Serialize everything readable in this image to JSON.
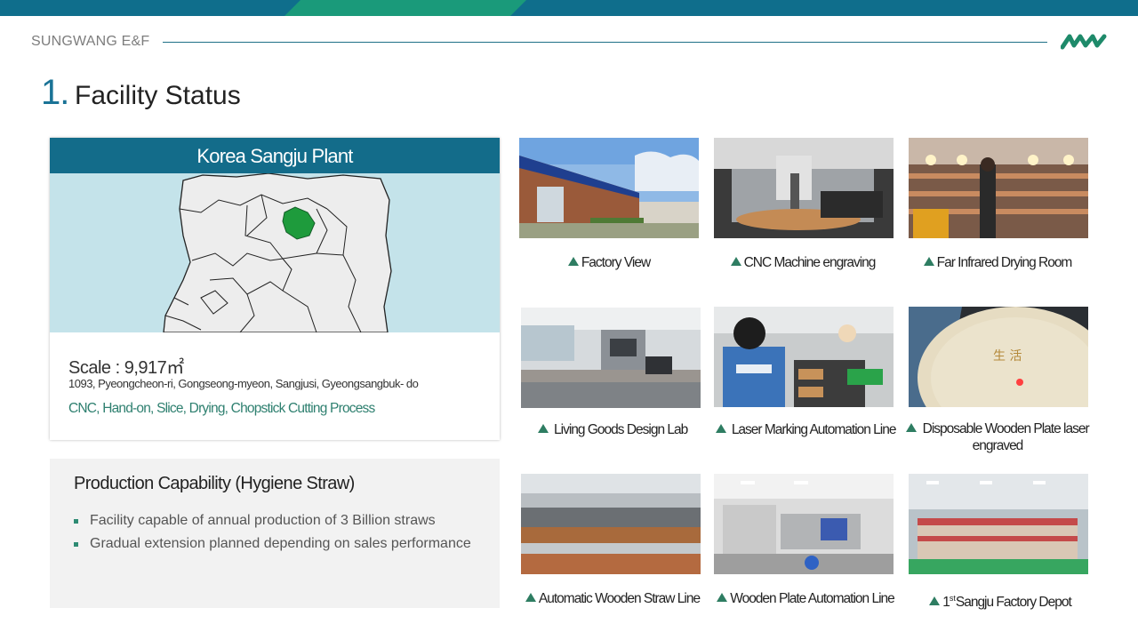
{
  "header": {
    "brand": "SUNGWANG E&F",
    "section_number": "1.",
    "section_title": "Facility Status"
  },
  "plant": {
    "title": "Korea Sangju Plant",
    "scale": "Scale : 9,917㎡",
    "address": "1093, Pyeongcheon-ri,  Gongseong-myeon,  Sangjusi,  Gyeongsangbuk-  do",
    "process": "CNC, Hand-on, Slice, Drying, Chopstick Cutting Process"
  },
  "capability": {
    "title": "Production Capability (Hygiene Straw)",
    "items": [
      "Facility capable of annual production of 3 Billion straws",
      "Gradual extension planned depending on sales performance"
    ]
  },
  "photos": [
    {
      "caption": "Factory View"
    },
    {
      "caption": "CNC Machine engraving"
    },
    {
      "caption": "Far Infrared Drying Room"
    },
    {
      "caption": "Living Goods Design Lab"
    },
    {
      "caption": "Laser Marking Automation Line"
    },
    {
      "caption": "Disposable Wooden Plate laser engraved"
    },
    {
      "caption": "Automatic Wooden Straw Line"
    },
    {
      "caption": "Wooden Plate Automation Line"
    },
    {
      "caption_prefix": "1",
      "caption_sup": "st",
      "caption": "Sangju Factory Depot"
    }
  ],
  "colors": {
    "primary": "#136c8a",
    "accent_green": "#2e8b73",
    "map_water": "#c4e3ea",
    "map_highlight": "#1e9b3c"
  }
}
